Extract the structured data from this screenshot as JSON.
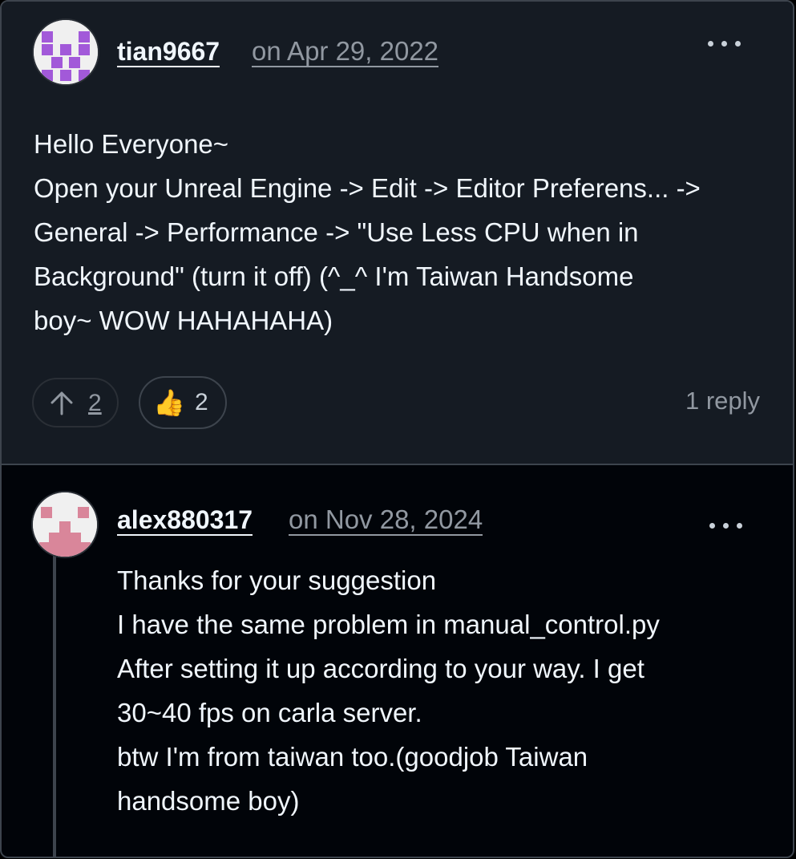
{
  "comment": {
    "author": "tian9667",
    "date": "on Apr 29, 2022",
    "body": "Hello Everyone~\nOpen your Unreal Engine -> Edit -> Editor Preferens... ->\nGeneral -> Performance -> \"Use Less CPU when in\nBackground\" (turn it off) (^_^ I'm Taiwan Handsome\nboy~ WOW HAHAHAHA)",
    "upvote_count": "2",
    "reaction_emoji": "👍",
    "reaction_count": "2",
    "reply_count_label": "1 reply",
    "avatar_color": "#a259d9"
  },
  "reply": {
    "author": "alex880317",
    "date": "on Nov 28, 2024",
    "body": "Thanks for your suggestion\nI have the same problem in manual_control.py\nAfter setting it up according to your way. I get\n30~40 fps on carla server.\nbtw I'm from taiwan too.(goodjob Taiwan\nhandsome boy)",
    "avatar_color": "#d9869a"
  },
  "icons": {
    "menu": "kebab-horizontal-icon",
    "upvote": "arrow-up-icon"
  }
}
